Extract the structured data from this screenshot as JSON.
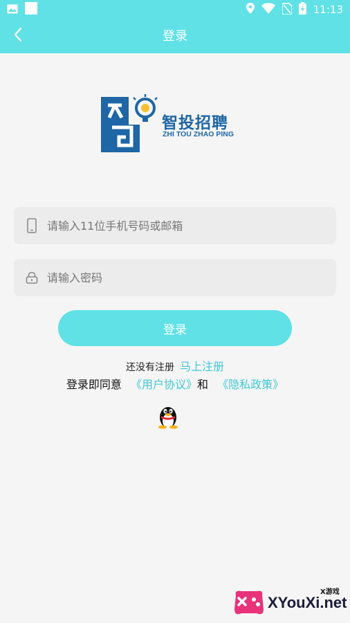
{
  "status_bar": {
    "time": "11:13",
    "icons": [
      "image-icon",
      "square-icon",
      "location-icon",
      "wifi-icon",
      "no-sim-icon",
      "battery-icon"
    ]
  },
  "nav": {
    "title": "登录",
    "back_icon": "chevron-left-icon"
  },
  "logo": {
    "name_cn": "智投招聘",
    "name_en": "ZHI TOU ZHAO PING"
  },
  "form": {
    "account_placeholder": "请输入11位手机号码或邮箱",
    "account_icon": "phone-icon",
    "password_placeholder": "请输入密码",
    "password_icon": "lock-icon",
    "login_label": "登录"
  },
  "register": {
    "prompt": "还没有注册",
    "link": "马上注册"
  },
  "agreement": {
    "prefix": "登录即同意",
    "user_agreement": "《用户协议》",
    "and": "和",
    "privacy_policy": "《隐私政策》"
  },
  "social": {
    "qq_icon": "qq-penguin-icon"
  },
  "watermark": {
    "site": "XYouXi.net",
    "label": "X游戏"
  },
  "colors": {
    "accent": "#5fe1e6",
    "link": "#3ec8d6",
    "logo_blue": "#1e66a6",
    "background": "#f5f5f5",
    "field_bg": "#ececec"
  }
}
